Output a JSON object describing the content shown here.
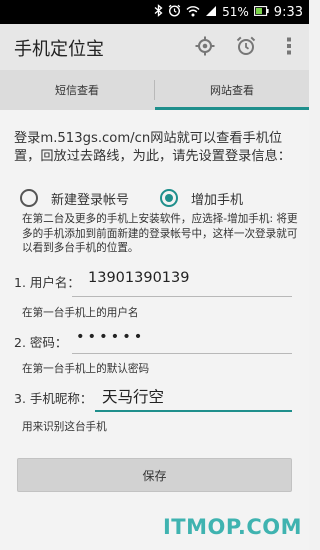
{
  "status_bar": {
    "battery": "51%",
    "time": "9:33"
  },
  "action_bar": {
    "title": "手机定位宝"
  },
  "tabs": [
    {
      "label": "短信查看",
      "active": false
    },
    {
      "label": "网站查看",
      "active": true
    }
  ],
  "intro_text": "登录m.513gs.com/cn网站就可以查看手机位置，回放过去路线，为此，请先设置登录信息：",
  "options": {
    "new_account": {
      "label": "新建登录帐号",
      "checked": false
    },
    "add_phone": {
      "label": "增加手机",
      "checked": true
    }
  },
  "note_text": "在第二台及更多的手机上安装软件，应选择-增加手机: 将更多的手机添加到前面新建的登录帐号中，这样一次登录就可以看到多台手机的位置。",
  "form": {
    "username": {
      "label": "1. 用户名：",
      "value": "13901390139",
      "hint": "在第一台手机上的用户名"
    },
    "password": {
      "label": "2. 密码：",
      "value": "••••••",
      "hint": "在第一台手机上的默认密码"
    },
    "nickname": {
      "label": "3. 手机昵称：",
      "value": "天马行空",
      "hint": "用来识别这台手机"
    }
  },
  "save_label": "保存",
  "watermark": "ITMOP.COM",
  "colors": {
    "accent": "#1f8f8c",
    "watermark": "#3fb3b0"
  }
}
